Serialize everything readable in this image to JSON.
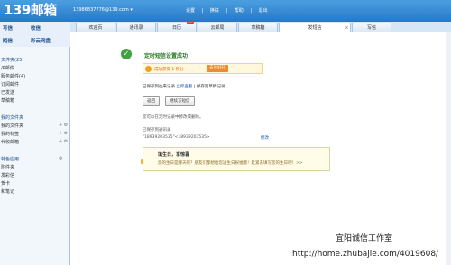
{
  "header": {
    "logo": "139邮箱",
    "user": "13986837776@139.com ▾",
    "links": [
      "设置",
      "|",
      "换肤",
      "|",
      "帮助",
      "|",
      "退出"
    ]
  },
  "left_actions": {
    "write": "写信",
    "receive": "收信",
    "sms": "短信",
    "disk": "彩云网盘"
  },
  "tabs": [
    {
      "label": "欢迎页"
    },
    {
      "label": "通讯录"
    },
    {
      "label": "日历",
      "badge": "new"
    },
    {
      "label": "云邮局"
    },
    {
      "label": "草稿箱"
    },
    {
      "label": "发短信",
      "active": true,
      "close": "x"
    },
    {
      "label": "写信"
    }
  ],
  "sidebar": {
    "items": [
      "文件夹(25)",
      "/P邮件",
      "服务邮件(4)",
      "订阅邮件",
      "已发送",
      "草稿箱",
      "我的文件夹",
      "我的文件夹",
      "我的标签",
      "代收邮箱",
      "特色应用",
      "附件夹",
      "发彩信",
      "贺卡",
      "和笔记"
    ]
  },
  "main": {
    "title": "定时短信设置成功！",
    "reward_text": "成功获得 1 积分",
    "reward_button": "去兑好礼",
    "saved_prefix": "已保存到往来记录",
    "view_now": "立即查看",
    "saved_suffix": "| 保存到草稿记录",
    "btn_back": "返回",
    "btn_continue": "继续写短信",
    "hint": "您可以在定时记录中修改或删除。",
    "saved_to": "已保存到通讯录",
    "recipients": "\"18939203535\"<18939203535>",
    "edit": "修改",
    "bday_title": "填生日，享惊喜",
    "bday_text": "您的生日是哪天呢？朋友们都想给您送生日祝福哦！赶紧去填写您的生日吧！>>"
  },
  "watermark": {
    "line1": "宜阳诚信工作室",
    "line2": "http://home.zhubajie.com/4019608/"
  }
}
